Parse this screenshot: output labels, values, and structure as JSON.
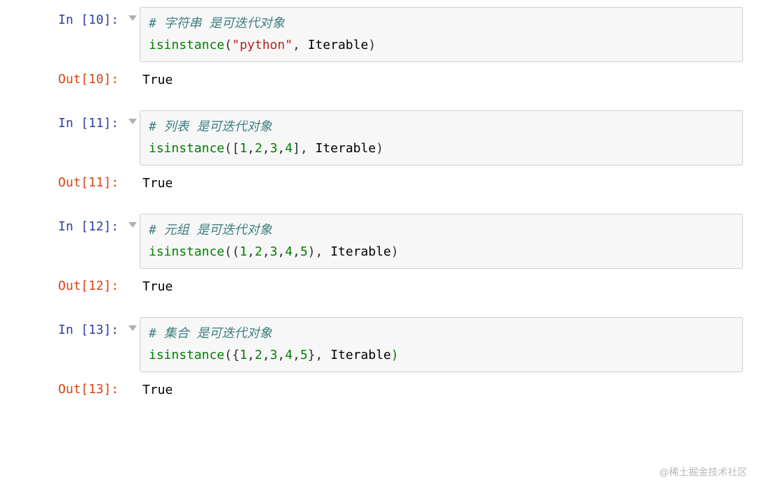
{
  "watermark": "@稀土掘金技术社区",
  "cells": [
    {
      "in_prompt": "In [10]:",
      "out_prompt": "Out[10]:",
      "comment": "# 字符串 是可迭代对象",
      "tok": {
        "fn": "isinstance",
        "open": "(",
        "arg1_q1": "\"",
        "arg1_body": "python",
        "arg1_q2": "\"",
        "comma": ", ",
        "arg2": "Iterable",
        "close": ")"
      },
      "output": "True"
    },
    {
      "in_prompt": "In [11]:",
      "out_prompt": "Out[11]:",
      "comment": "# 列表 是可迭代对象",
      "tok": {
        "fn": "isinstance",
        "open": "(",
        "coll_open": "[",
        "items": [
          {
            "n": "1",
            "sep": ","
          },
          {
            "n": "2",
            "sep": ","
          },
          {
            "n": "3",
            "sep": ","
          },
          {
            "n": "4",
            "sep": ""
          }
        ],
        "coll_close": "]",
        "comma": ", ",
        "arg2": "Iterable",
        "close": ")"
      },
      "output": "True"
    },
    {
      "in_prompt": "In [12]:",
      "out_prompt": "Out[12]:",
      "comment": "# 元组 是可迭代对象",
      "tok": {
        "fn": "isinstance",
        "open": "(",
        "coll_open": "(",
        "items": [
          {
            "n": "1",
            "sep": ","
          },
          {
            "n": "2",
            "sep": ","
          },
          {
            "n": "3",
            "sep": ","
          },
          {
            "n": "4",
            "sep": ","
          },
          {
            "n": "5",
            "sep": ""
          }
        ],
        "coll_close": ")",
        "comma": ", ",
        "arg2": "Iterable",
        "close": ")"
      },
      "output": "True"
    },
    {
      "in_prompt": "In [13]:",
      "out_prompt": "Out[13]:",
      "comment": "# 集合 是可迭代对象",
      "tok": {
        "fn": "isinstance",
        "open": "(",
        "coll_open": "{",
        "items": [
          {
            "n": "1",
            "sep": ","
          },
          {
            "n": "2",
            "sep": ","
          },
          {
            "n": "3",
            "sep": ","
          },
          {
            "n": "4",
            "sep": ","
          },
          {
            "n": "5",
            "sep": ""
          }
        ],
        "coll_close": "}",
        "comma": ", ",
        "arg2": "Iterable",
        "close": ")"
      },
      "output": "True"
    }
  ]
}
